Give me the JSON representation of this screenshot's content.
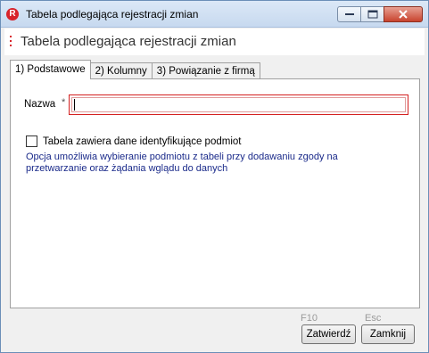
{
  "window": {
    "title": "Tabela podlegająca rejestracji zmian",
    "app_icon_letter": "R"
  },
  "header": {
    "title": "Tabela podlegająca rejestracji zmian"
  },
  "tabs": [
    {
      "label": "1) Podstawowe",
      "active": true
    },
    {
      "label": "2) Kolumny",
      "active": false
    },
    {
      "label": "3) Powiązanie z firmą",
      "active": false
    }
  ],
  "form": {
    "nazwa_label": "Nazwa",
    "required_marker": "*",
    "nazwa_value": "",
    "checkbox_label": "Tabela zawiera dane identyfikujące podmiot",
    "checkbox_checked": false,
    "description": "Opcja umożliwia wybieranie podmiotu z tabeli przy dodawaniu zgody na przetwarzanie oraz żądania wglądu do danych"
  },
  "footer": {
    "confirm_shortcut": "F10",
    "confirm_label": "Zatwierdź",
    "close_shortcut": "Esc",
    "close_label": "Zamknij"
  },
  "colors": {
    "accent": "#d8232a",
    "description_text": "#1a2a8a"
  }
}
